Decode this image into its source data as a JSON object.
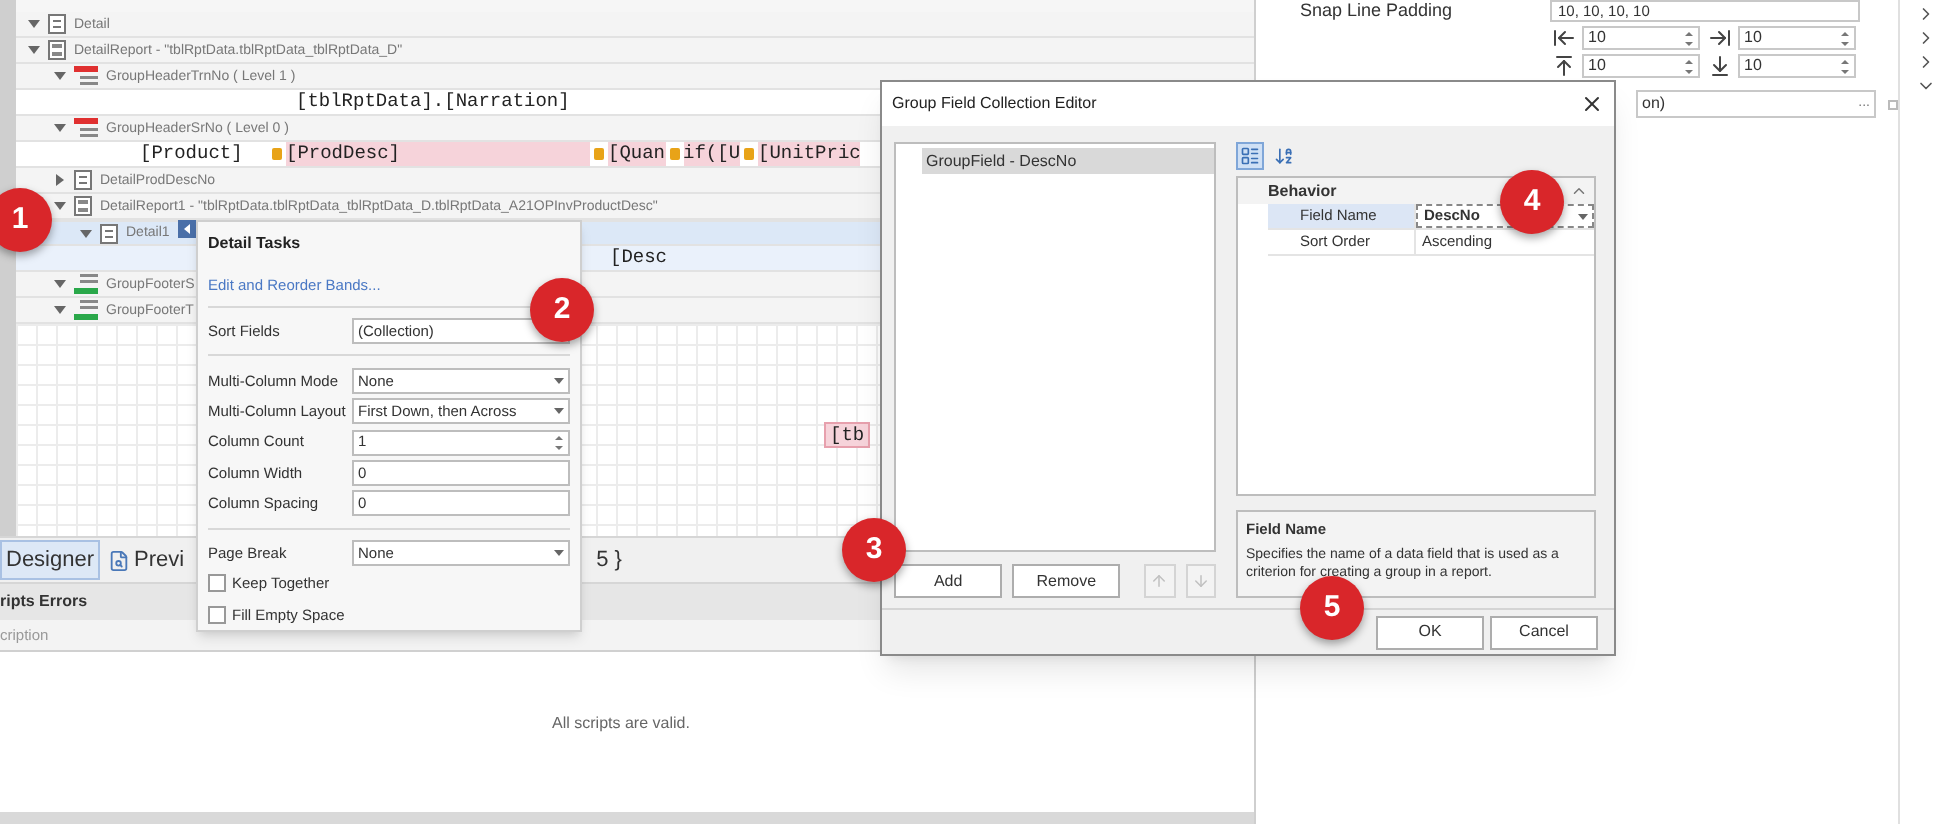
{
  "band_tree": [
    {
      "kind": "detail",
      "label": "Detail",
      "expanded": true,
      "selected": false
    },
    {
      "kind": "report",
      "label": "DetailReport - \"tblRptData.tblRptData_tblRptData_D\"",
      "expanded": true,
      "selected": false,
      "children": [
        {
          "kind": "group_header",
          "label": "GroupHeaderTrnNo ( Level 1 )",
          "expanded": true,
          "selected": false,
          "fields": [
            {
              "text": "[tblRptData].[Narration]",
              "highlighted": false
            }
          ]
        },
        {
          "kind": "group_header",
          "label": "GroupHeaderSrNo ( Level 0 )",
          "expanded": true,
          "selected": false,
          "fields": [
            {
              "text": "[Product]",
              "highlighted": false
            },
            {
              "text": "[ProdDesc]",
              "highlighted": true
            },
            {
              "text": "[Quan",
              "highlighted": true
            },
            {
              "text": "if([U",
              "highlighted": true
            },
            {
              "text": "[UnitPric",
              "highlighted": true
            }
          ]
        },
        {
          "kind": "detail",
          "label": "DetailProdDescNo",
          "expanded": false,
          "selected": false
        },
        {
          "kind": "report",
          "label": "DetailReport1 - \"tblRptData.tblRptData_tblRptData_D.tblRptData_A21OPInvProductDesc\"",
          "expanded": true,
          "selected": false,
          "children": [
            {
              "kind": "detail",
              "label": "Detail1",
              "expanded": true,
              "selected": true,
              "fields": [
                {
                  "text": "[Desc",
                  "highlighted": false
                }
              ]
            }
          ]
        },
        {
          "kind": "group_footer",
          "label": "GroupFooterS",
          "expanded": true,
          "selected": false
        },
        {
          "kind": "group_footer",
          "label": "GroupFooterT",
          "expanded": true,
          "selected": false
        }
      ]
    }
  ],
  "canvas_field": {
    "text": "[tb",
    "highlighted": true
  },
  "tabs": [
    {
      "kind": "designer",
      "label": "Designer",
      "selected": true
    },
    {
      "kind": "preview",
      "label": "Previ",
      "selected": false
    },
    {
      "kind": "plain",
      "label": "5 }",
      "selected": false
    }
  ],
  "errors_panel": {
    "title": "ripts Errors",
    "column": "cription",
    "message": "All scripts are valid."
  },
  "properties_panel": {
    "snap_line_padding": {
      "label": "Snap Line Padding",
      "value": "10, 10, 10, 10"
    },
    "padding_fields": [
      {
        "kind": "left",
        "value": "10"
      },
      {
        "kind": "right",
        "value": "10"
      },
      {
        "kind": "top",
        "value": "10"
      },
      {
        "kind": "bottom",
        "value": "10"
      }
    ],
    "collection_field": {
      "value": "on)",
      "button": "..."
    },
    "section_toggles": [
      {
        "expanded": false
      },
      {
        "expanded": false
      },
      {
        "expanded": false
      },
      {
        "expanded": true
      }
    ]
  },
  "detail_tasks": {
    "title": "Detail Tasks",
    "link": "Edit and Reorder Bands...",
    "rows": [
      {
        "kind": "field",
        "label": "Sort Fields",
        "value": "(Collection)"
      },
      {
        "kind": "divider"
      },
      {
        "kind": "dropdown",
        "label": "Multi-Column Mode",
        "value": "None"
      },
      {
        "kind": "dropdown",
        "label": "Multi-Column Layout",
        "value": "First Down, then Across"
      },
      {
        "kind": "spin",
        "label": "Column Count",
        "value": "1"
      },
      {
        "kind": "field",
        "label": "Column Width",
        "value": "0"
      },
      {
        "kind": "field",
        "label": "Column Spacing",
        "value": "0"
      },
      {
        "kind": "divider"
      },
      {
        "kind": "dropdown",
        "label": "Page Break",
        "value": "None"
      },
      {
        "kind": "checkbox",
        "label": "Keep Together",
        "checked": false
      },
      {
        "kind": "checkbox",
        "label": "Fill Empty Space",
        "checked": false
      }
    ]
  },
  "dialog": {
    "title": "Group Field Collection Editor",
    "items": [
      {
        "label": "GroupField - DescNo",
        "selected": true
      }
    ],
    "list_buttons": [
      {
        "kind": "text",
        "label": "Add",
        "disabled": false
      },
      {
        "kind": "text",
        "label": "Remove",
        "disabled": false
      },
      {
        "kind": "up",
        "disabled": true
      },
      {
        "kind": "down",
        "disabled": true
      }
    ],
    "toolbar": [
      {
        "kind": "categorized",
        "selected": true
      },
      {
        "kind": "alphabetical",
        "selected": false
      }
    ],
    "category": {
      "label": "Behavior",
      "expanded": true
    },
    "properties": [
      {
        "name": "Field Name",
        "value": "DescNo",
        "selected": true
      },
      {
        "name": "Sort Order",
        "value": "Ascending",
        "selected": false
      }
    ],
    "description": {
      "title": "Field Name",
      "text": "Specifies the name of a data field that is used as a criterion for creating a group in a report."
    },
    "buttons": [
      "OK",
      "Cancel"
    ]
  },
  "callouts": [
    "1",
    "2",
    "3",
    "4",
    "5"
  ]
}
